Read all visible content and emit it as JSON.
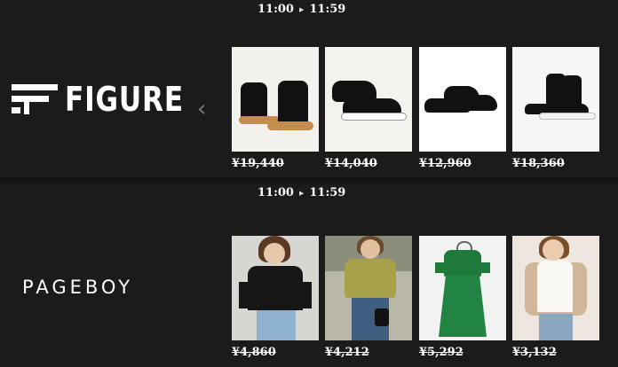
{
  "sections": [
    {
      "time": {
        "start": "11:00",
        "end": "11:59"
      },
      "brand": "FIGURE",
      "products": [
        {
          "price": "¥19,440",
          "image": "sneaker-gum-sole"
        },
        {
          "price": "¥14,040",
          "image": "sneaker-black-white"
        },
        {
          "price": "¥12,960",
          "image": "sneaker-all-black"
        },
        {
          "price": "¥18,360",
          "image": "sneaker-high-top"
        }
      ]
    },
    {
      "time": {
        "start": "11:00",
        "end": "11:59"
      },
      "brand": "PAGEBOY",
      "products": [
        {
          "price": "¥4,860",
          "image": "black-cold-shoulder-top"
        },
        {
          "price": "¥4,212",
          "image": "floral-blouse"
        },
        {
          "price": "¥5,292",
          "image": "green-dress"
        },
        {
          "price": "¥3,132",
          "image": "lace-top"
        }
      ]
    }
  ],
  "icons": {
    "prev": "chevron-left-icon",
    "arrow": "play-arrow-icon"
  }
}
